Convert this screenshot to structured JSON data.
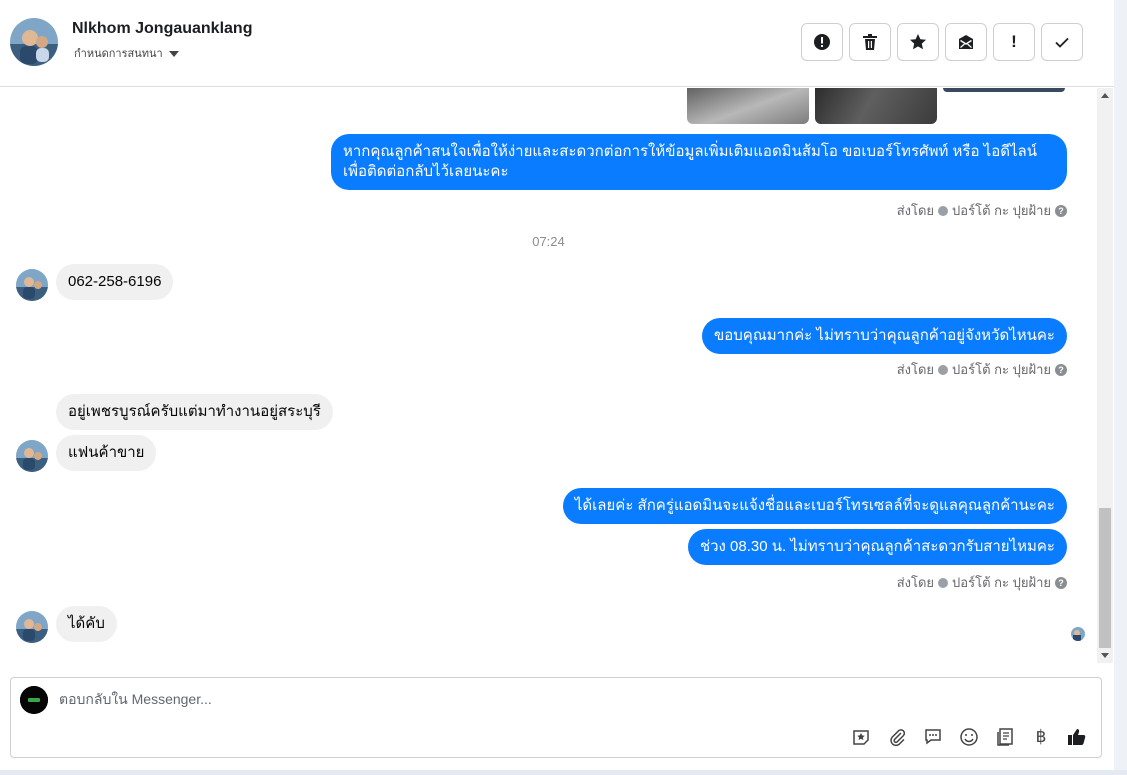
{
  "header": {
    "contact_name": "Nlkhom Jongauanklang",
    "subtitle": "กำหนดการสนทนา",
    "actions": [
      "report-icon",
      "trash-icon",
      "star-icon",
      "mail-icon",
      "important-icon",
      "done-icon"
    ],
    "important_glyph": "!"
  },
  "conversation": {
    "out_1": "หากคุณลูกค้าสนใจเพื่อให้ง่ายและสะดวกต่อการให้ข้อมูลเพิ่มเติมแอดมินส้มโอ ขอเบอร์โทรศัพท์ หรือ ไอดีไลน์",
    "out_1b": "เพื่อติดต่อกลับไว้เลยนะคะ",
    "sent_by_label": "ส่งโดย",
    "sender_name": "ปอร์โต้ กะ ปุยฝ้าย",
    "help_glyph": "?",
    "timestamp": "07:24",
    "in_1": "062-258-6196",
    "out_2": "ขอบคุณมากค่ะ ไม่ทราบว่าคุณลูกค้าอยู่จังหวัดไหนคะ",
    "in_2": "อยู่เพชรบูรณ์ครับแต่มาทำงานอยู่สระบุรี",
    "in_3": "แฟนค้าขาย",
    "out_3": "ได้เลยค่ะ สักครู่แอดมินจะแจ้งชื่อและเบอร์โทรเซลล์ที่จะดูแลคุณลูกค้านะคะ",
    "out_4": "ช่วง 08.30 น. ไม่ทราบว่าคุณลูกค้าสะดวกรับสายไหมคะ",
    "in_4": "ได้คับ"
  },
  "composer": {
    "placeholder": "ตอบกลับใน Messenger...",
    "tools": [
      "sticker-icon",
      "attach-icon",
      "saved-replies-icon",
      "emoji-icon",
      "notes-icon",
      "baht-icon",
      "like-icon"
    ],
    "baht_glyph": "฿"
  },
  "colors": {
    "outgoing_bubble": "#0a7cff",
    "incoming_bubble": "#f0f0f0"
  }
}
